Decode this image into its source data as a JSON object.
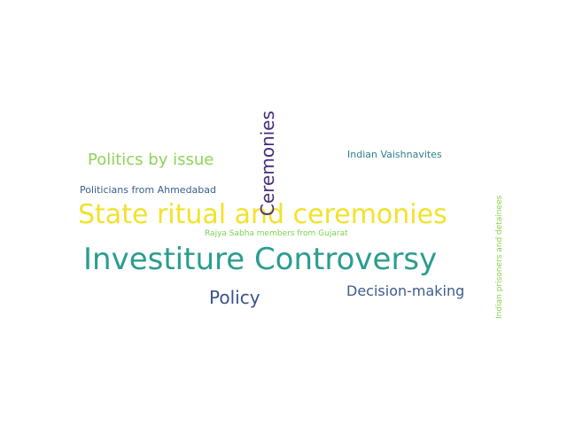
{
  "words": [
    {
      "text": "Investiture Controversy",
      "color": "#2a9d8f"
    },
    {
      "text": "State ritual and ceremonies",
      "color": "#f2e22c"
    },
    {
      "text": "Politics by issue",
      "color": "#8fd35a"
    },
    {
      "text": "Ceremonies",
      "color": "#472d7b"
    },
    {
      "text": "Policy",
      "color": "#3b528b"
    },
    {
      "text": "Decision-making",
      "color": "#3e5c8a"
    },
    {
      "text": "Politicians from Ahmedabad",
      "color": "#355f8d"
    },
    {
      "text": "Indian Vaishnavites",
      "color": "#2c7f8e"
    },
    {
      "text": "Rajya Sabha members from Gujarat",
      "color": "#7ad151"
    },
    {
      "text": "Indian prisoners and detainees",
      "color": "#86d549"
    }
  ]
}
